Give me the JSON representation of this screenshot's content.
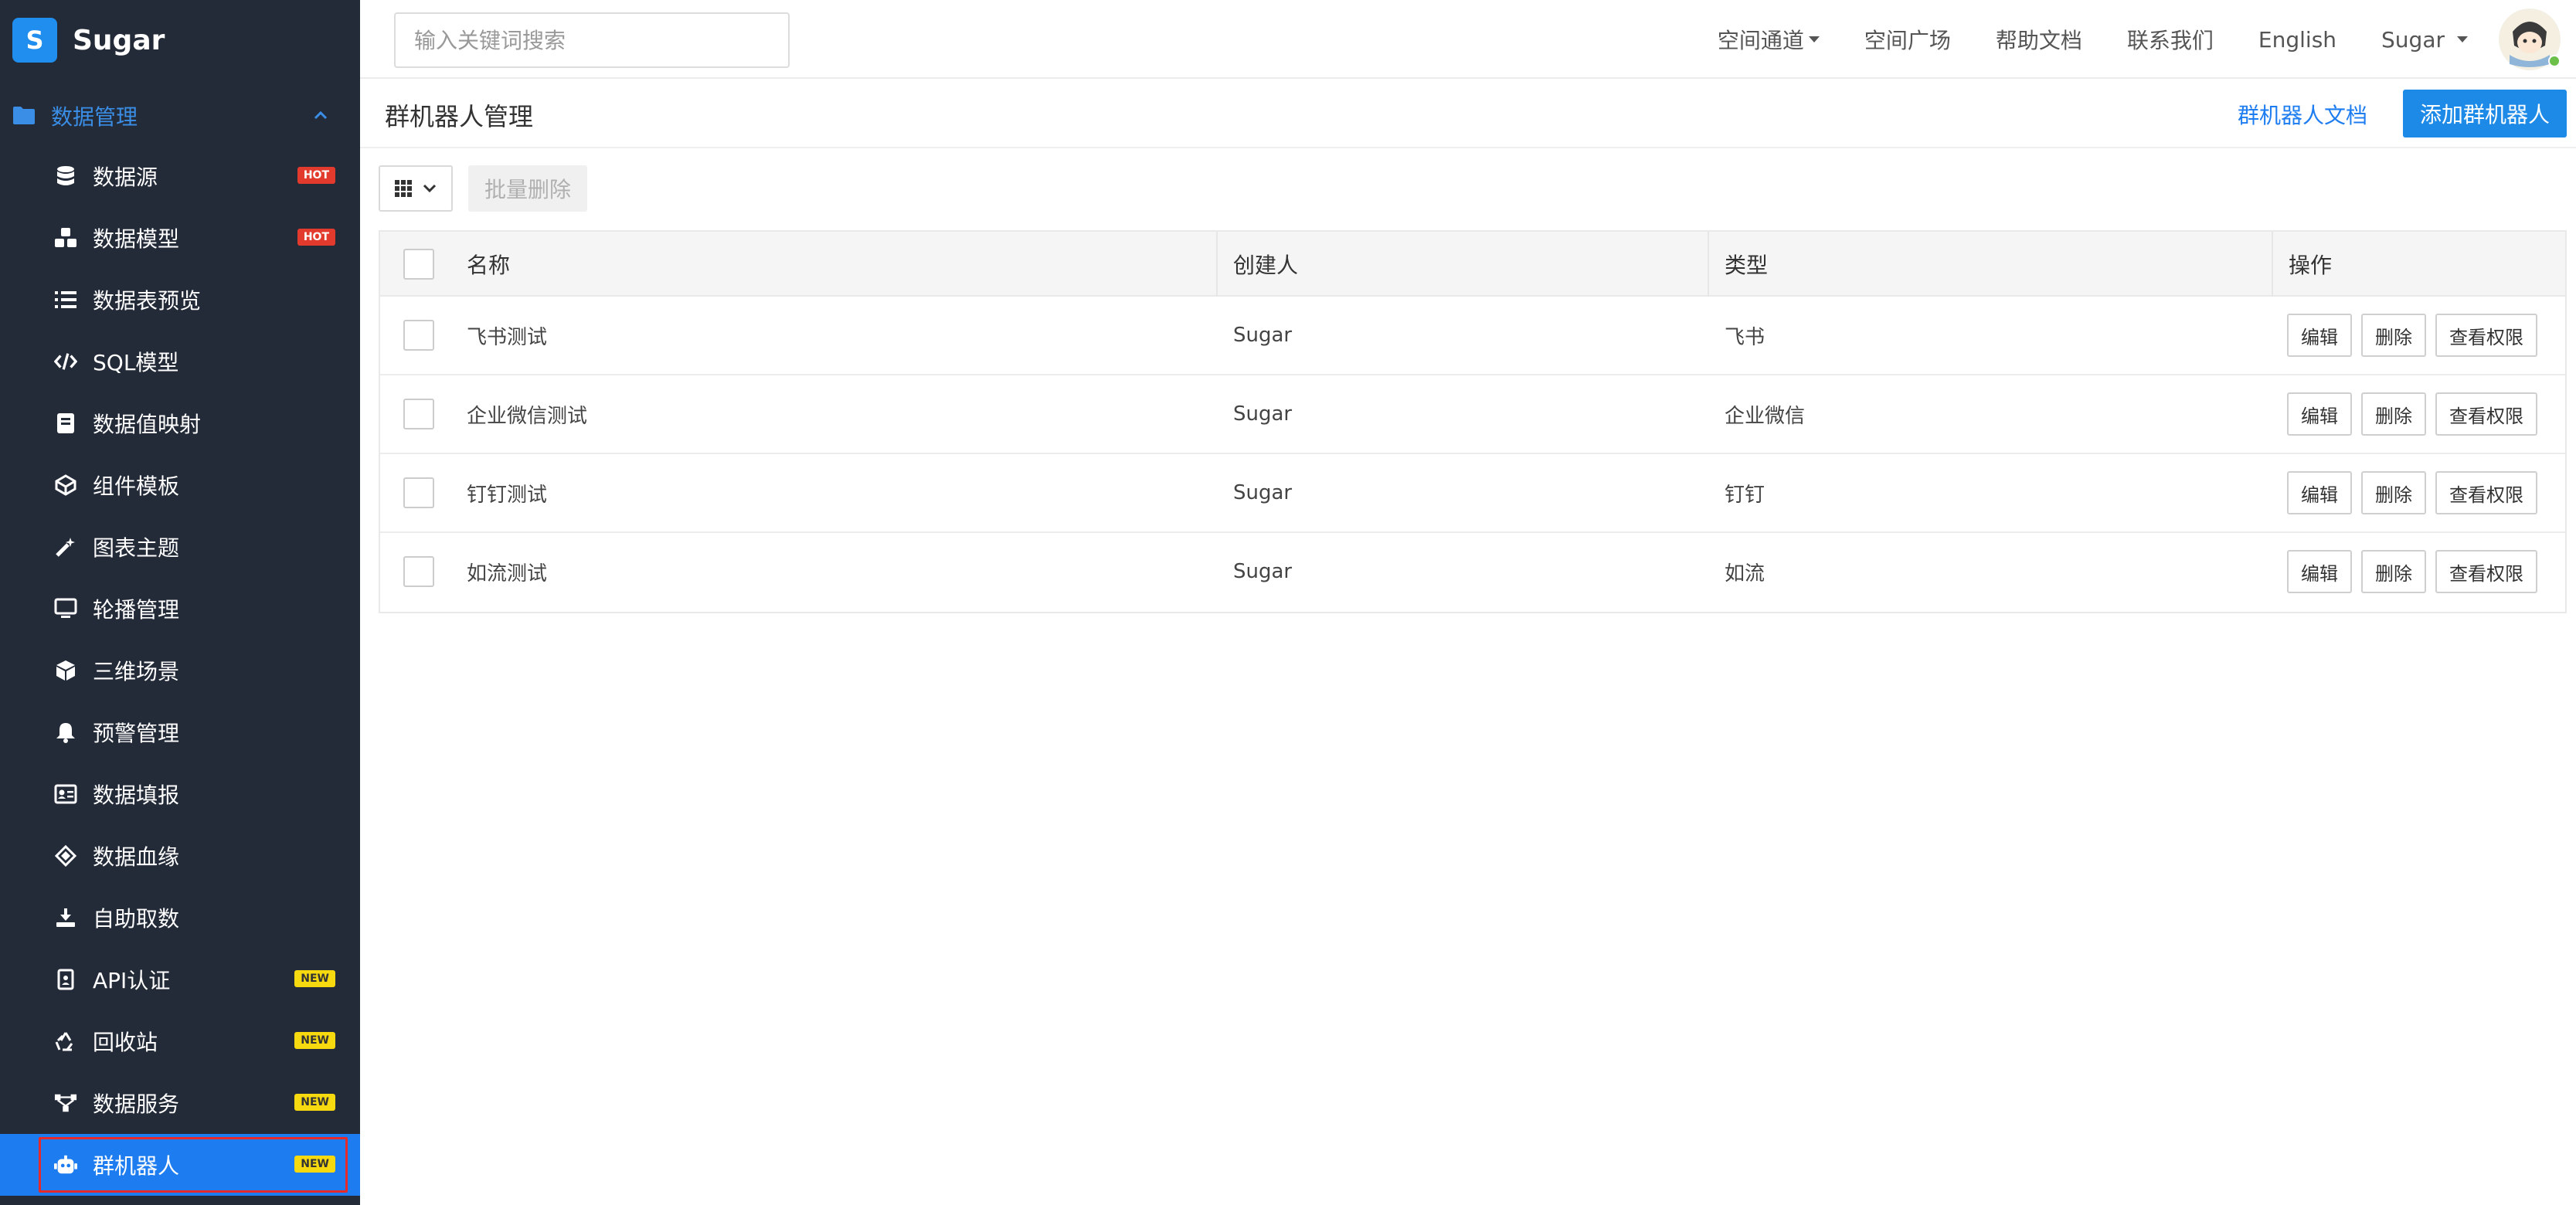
{
  "brand": {
    "logo_letter": "S",
    "name": "Sugar"
  },
  "sidebar": {
    "group_label": "数据管理",
    "items": [
      {
        "label": "数据源",
        "icon": "database-icon",
        "badge": "HOT",
        "badge_type": "hot"
      },
      {
        "label": "数据模型",
        "icon": "cubes-icon",
        "badge": "HOT",
        "badge_type": "hot"
      },
      {
        "label": "数据表预览",
        "icon": "list-icon",
        "badge": "",
        "badge_type": ""
      },
      {
        "label": "SQL模型",
        "icon": "code-icon",
        "badge": "",
        "badge_type": ""
      },
      {
        "label": "数据值映射",
        "icon": "book-icon",
        "badge": "",
        "badge_type": ""
      },
      {
        "label": "组件模板",
        "icon": "component-icon",
        "badge": "",
        "badge_type": ""
      },
      {
        "label": "图表主题",
        "icon": "magic-wand-icon",
        "badge": "",
        "badge_type": ""
      },
      {
        "label": "轮播管理",
        "icon": "monitor-icon",
        "badge": "",
        "badge_type": ""
      },
      {
        "label": "三维场景",
        "icon": "cube-icon",
        "badge": "",
        "badge_type": ""
      },
      {
        "label": "预警管理",
        "icon": "bell-icon",
        "badge": "",
        "badge_type": ""
      },
      {
        "label": "数据填报",
        "icon": "id-card-icon",
        "badge": "",
        "badge_type": ""
      },
      {
        "label": "数据血缘",
        "icon": "layers-icon",
        "badge": "",
        "badge_type": ""
      },
      {
        "label": "自助取数",
        "icon": "download-icon",
        "badge": "",
        "badge_type": ""
      },
      {
        "label": "API认证",
        "icon": "badge-icon",
        "badge": "NEW",
        "badge_type": "new"
      },
      {
        "label": "回收站",
        "icon": "recycle-icon",
        "badge": "NEW",
        "badge_type": "new"
      },
      {
        "label": "数据服务",
        "icon": "network-icon",
        "badge": "NEW",
        "badge_type": "new"
      },
      {
        "label": "群机器人",
        "icon": "robot-icon",
        "badge": "NEW",
        "badge_type": "new"
      }
    ]
  },
  "topbar": {
    "search_placeholder": "输入关键词搜索",
    "nav": [
      "空间通道",
      "空间广场",
      "帮助文档",
      "联系我们",
      "English"
    ],
    "user_name": "Sugar"
  },
  "page": {
    "title": "群机器人管理",
    "doc_link": "群机器人文档",
    "add_button": "添加群机器人"
  },
  "toolbar": {
    "batch_delete": "批量删除"
  },
  "table": {
    "columns": [
      "名称",
      "创建人",
      "类型",
      "操作"
    ],
    "rows": [
      {
        "name": "飞书测试",
        "creator": "Sugar",
        "type": "飞书"
      },
      {
        "name": "企业微信测试",
        "creator": "Sugar",
        "type": "企业微信"
      },
      {
        "name": "钉钉测试",
        "creator": "Sugar",
        "type": "钉钉"
      },
      {
        "name": "如流测试",
        "creator": "Sugar",
        "type": "如流"
      }
    ],
    "actions": {
      "edit": "编辑",
      "delete": "删除",
      "permissions": "查看权限"
    }
  },
  "colors": {
    "sidebar_bg": "#232a38",
    "accent": "#1d7df0",
    "hot": "#e23a2c",
    "new": "#f6d90f"
  }
}
